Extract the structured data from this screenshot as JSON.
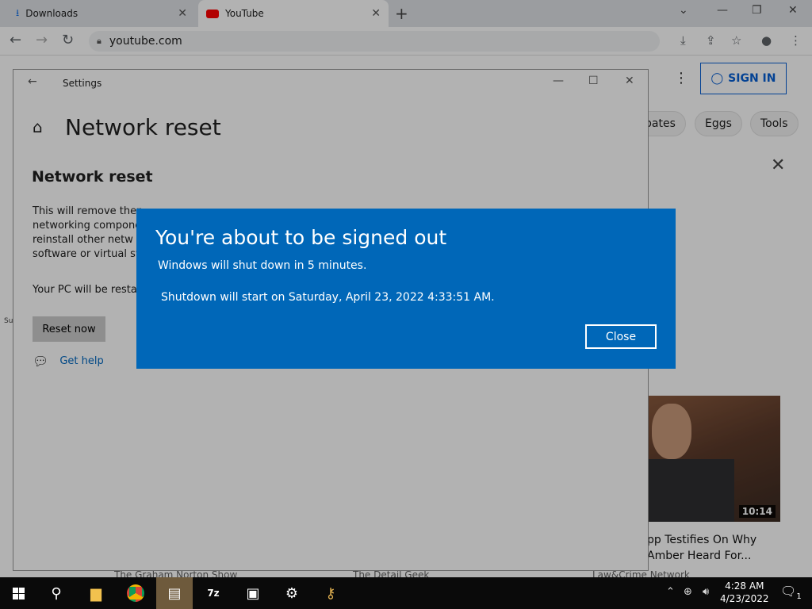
{
  "browser": {
    "tabs": [
      {
        "label": "Downloads",
        "icon": "download-icon",
        "active": false
      },
      {
        "label": "YouTube",
        "icon": "youtube-icon",
        "active": true
      }
    ],
    "url": "youtube.com"
  },
  "youtube": {
    "sign_in": "SIGN IN",
    "chips": [
      "pates",
      "Eggs",
      "Tools"
    ],
    "video": {
      "duration": "10:14",
      "title": "pp Testifies On Why Amber Heard For..."
    },
    "channels": [
      "The Graham Norton Show",
      "The Detail Geek",
      "Law&Crime Network"
    ],
    "edge_text": "Su"
  },
  "settings": {
    "window_title": "Settings",
    "page_heading": "Network reset",
    "section_heading": "Network reset",
    "description": "This will remove then networking compone to reinstall other netw software or virtual sw",
    "restart_note": "Your PC will be restar",
    "reset_button": "Reset now",
    "help_link": "Get help"
  },
  "dialog": {
    "title": "You're about to be signed out",
    "message": "Windows will shut down in 5 minutes.",
    "when": "Shutdown will start on Saturday, April 23, 2022 4:33:51 AM.",
    "close_label": "Close",
    "background_color": "#0067b8"
  },
  "taskbar": {
    "time": "4:28 AM",
    "date": "4/23/2022",
    "notification_count": "1"
  }
}
